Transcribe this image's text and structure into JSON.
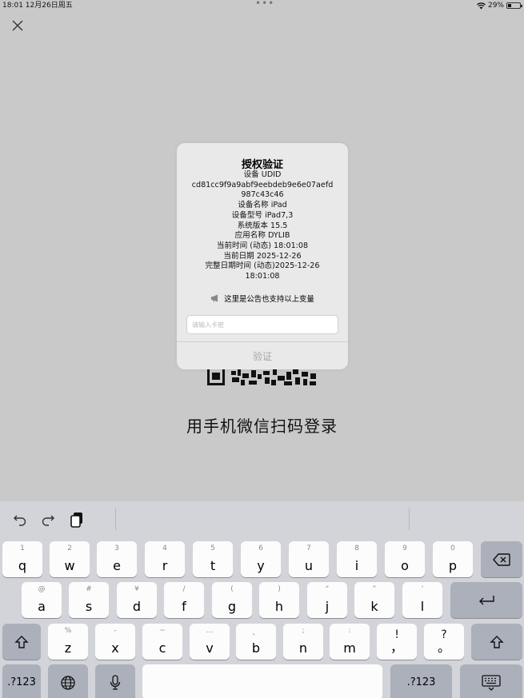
{
  "status_bar": {
    "time_date": "18:01  12月26日周五",
    "battery": "29%"
  },
  "dialog": {
    "title": "授权验证",
    "lines": [
      "设备 UDID",
      "cd81cc9f9a9abf9eebdeb9e6e07aefd",
      "987c43c46",
      "设备名称 iPad",
      "设备型号 iPad7,3",
      "系统版本 15.5",
      "应用名称 DYLIB",
      "当前时间 (动态) 18:01:08",
      "当前日期 2025-12-26",
      "完整日期时间 (动态)2025-12-26",
      "18:01:08"
    ],
    "notice": "这里是公告也支持以上变量",
    "input_placeholder": "请输入卡密",
    "verify_label": "验证"
  },
  "scan_prompt": "用手机微信扫码登录",
  "keyboard": {
    "row1": [
      {
        "hint": "1",
        "key": "q"
      },
      {
        "hint": "2",
        "key": "w"
      },
      {
        "hint": "3",
        "key": "e"
      },
      {
        "hint": "4",
        "key": "r"
      },
      {
        "hint": "5",
        "key": "t"
      },
      {
        "hint": "6",
        "key": "y"
      },
      {
        "hint": "7",
        "key": "u"
      },
      {
        "hint": "8",
        "key": "i"
      },
      {
        "hint": "9",
        "key": "o"
      },
      {
        "hint": "0",
        "key": "p"
      }
    ],
    "row2": [
      {
        "hint": "@",
        "key": "a"
      },
      {
        "hint": "#",
        "key": "s"
      },
      {
        "hint": "¥",
        "key": "d"
      },
      {
        "hint": "/",
        "key": "f"
      },
      {
        "hint": "(",
        "key": "g"
      },
      {
        "hint": ")",
        "key": "h"
      },
      {
        "hint": "“",
        "key": "j"
      },
      {
        "hint": "”",
        "key": "k"
      },
      {
        "hint": "'",
        "key": "l"
      }
    ],
    "row3": [
      {
        "hint": "%",
        "key": "z"
      },
      {
        "hint": "-",
        "key": "x"
      },
      {
        "hint": "~",
        "key": "c"
      },
      {
        "hint": "…",
        "key": "v"
      },
      {
        "hint": "、",
        "key": "b"
      },
      {
        "hint": ";",
        "key": "n"
      },
      {
        "hint": ":",
        "key": "m"
      },
      {
        "hint": "!",
        "key": "，"
      },
      {
        "hint": "?",
        "key": "。"
      }
    ],
    "numbers_label": ".?123",
    "icons": {
      "undo": "undo-icon",
      "redo": "redo-icon",
      "paste": "clipboard-icon",
      "delete": "backspace-icon",
      "return": "return-icon",
      "shift": "shift-icon",
      "globe": "globe-icon",
      "mic": "microphone-icon",
      "dismiss": "keyboard-dismiss-icon"
    }
  }
}
